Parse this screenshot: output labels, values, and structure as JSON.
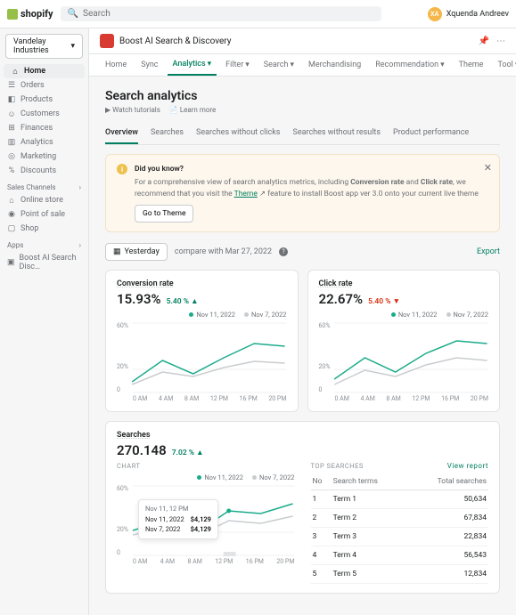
{
  "brand": "shopify",
  "search_placeholder": "Search",
  "user": {
    "initials": "XA",
    "name": "Xquenda Andreev"
  },
  "store": "Vandelay Industries",
  "nav": {
    "main": [
      {
        "icon": "⌂",
        "label": "Home"
      },
      {
        "icon": "☰",
        "label": "Orders"
      },
      {
        "icon": "◧",
        "label": "Products"
      },
      {
        "icon": "☺",
        "label": "Customers"
      },
      {
        "icon": "⊞",
        "label": "Finances"
      },
      {
        "icon": "▥",
        "label": "Analytics"
      },
      {
        "icon": "◎",
        "label": "Marketing"
      },
      {
        "icon": "%",
        "label": "Discounts"
      }
    ],
    "channels_label": "Sales channels",
    "channels": [
      {
        "icon": "⌂",
        "label": "Online store"
      },
      {
        "icon": "◉",
        "label": "Point of sale"
      },
      {
        "icon": "▢",
        "label": "Shop"
      }
    ],
    "apps_label": "Apps",
    "apps": [
      {
        "icon": "▣",
        "label": "Boost AI Search Disc…"
      }
    ]
  },
  "app_title": "Boost AI Search & Discovery",
  "tabs": [
    "Home",
    "Sync",
    "Analytics",
    "Filter",
    "Search",
    "Merchandising",
    "Recommendation",
    "Theme",
    "Tool"
  ],
  "active_tab": "Analytics",
  "page_title": "Search analytics",
  "sublinks": [
    "▶ Watch tutorials",
    "📄 Learn more"
  ],
  "subtabs": [
    "Overview",
    "Searches",
    "Searches without clicks",
    "Searches without results",
    "Product performance"
  ],
  "active_subtab": "Overview",
  "notice": {
    "title": "Did you know?",
    "body_a": "For a comprehensive view of search analytics metrics, including ",
    "bold_a": "Conversion rate",
    "body_b": " and ",
    "bold_b": "Click rate",
    "body_c": ", we recommend that you visit the ",
    "link": "Theme",
    "body_d": " feature to install Boost app ver 3.0 onto your current live theme",
    "cta": "Go to Theme"
  },
  "date": {
    "btn": "Yesterday",
    "compare": "compare with Mar 27, 2022",
    "export": "Export"
  },
  "cards": {
    "conv": {
      "title": "Conversion rate",
      "value": "15.93%",
      "delta": "5.40 % ▲",
      "dir": "up"
    },
    "click": {
      "title": "Click rate",
      "value": "22.67%",
      "delta": "5.40 % ▼",
      "dir": "down"
    },
    "searches": {
      "title": "Searches",
      "value": "270.148",
      "delta": "7.02 % ▲",
      "dir": "up",
      "chart_label": "CHART",
      "top_label": "TOP SEARCHES",
      "view": "View report"
    }
  },
  "legend": {
    "current": "Nov 11, 2022",
    "compare": "Nov 7, 2022"
  },
  "tooltip": {
    "time": "Nov 11, 12 PM",
    "rows": [
      {
        "date": "Nov 11, 2022",
        "val": "$4,129"
      },
      {
        "date": "Nov 7, 2022",
        "val": "$4,129"
      }
    ]
  },
  "table": {
    "cols": [
      "No",
      "Search terms",
      "Total searches"
    ],
    "rows": [
      {
        "no": "1",
        "term": "Term 1",
        "total": "50,634"
      },
      {
        "no": "2",
        "term": "Term 2",
        "total": "67,834"
      },
      {
        "no": "3",
        "term": "Term 3",
        "total": "22,834"
      },
      {
        "no": "4",
        "term": "Term 4",
        "total": "56,543"
      },
      {
        "no": "5",
        "term": "Term 5",
        "total": "12,834"
      }
    ]
  },
  "chart_data": [
    {
      "type": "line",
      "title": "Conversion rate",
      "ylabel": "%",
      "ylim": [
        0,
        60
      ],
      "x": [
        "0 AM",
        "4 AM",
        "8 AM",
        "12 PM",
        "16 PM",
        "20 PM"
      ],
      "series": [
        {
          "name": "Nov 11, 2022",
          "values": [
            10,
            28,
            16,
            30,
            42,
            40
          ]
        },
        {
          "name": "Nov 7, 2022",
          "values": [
            8,
            18,
            14,
            22,
            28,
            26
          ]
        }
      ]
    },
    {
      "type": "line",
      "title": "Click rate",
      "ylabel": "%",
      "ylim": [
        0,
        60
      ],
      "x": [
        "0 AM",
        "4 AM",
        "8 AM",
        "12 PM",
        "16 PM",
        "20 PM"
      ],
      "series": [
        {
          "name": "Nov 11, 2022",
          "values": [
            12,
            30,
            18,
            34,
            44,
            42
          ]
        },
        {
          "name": "Nov 7, 2022",
          "values": [
            8,
            20,
            14,
            24,
            30,
            28
          ]
        }
      ]
    },
    {
      "type": "line",
      "title": "Searches",
      "ylabel": "%",
      "ylim": [
        0,
        60
      ],
      "x": [
        "0 AM",
        "4 AM",
        "8 AM",
        "12 PM",
        "16 PM",
        "20 PM"
      ],
      "series": [
        {
          "name": "Nov 11, 2022",
          "values": [
            22,
            30,
            20,
            38,
            36,
            44
          ]
        },
        {
          "name": "Nov 7, 2022",
          "values": [
            18,
            24,
            16,
            30,
            28,
            34
          ]
        }
      ]
    }
  ],
  "xticks": [
    "0 AM",
    "4 AM",
    "8 AM",
    "12 PM",
    "16 PM",
    "20 PM"
  ],
  "yticks": [
    "0",
    "20%",
    "60%"
  ]
}
